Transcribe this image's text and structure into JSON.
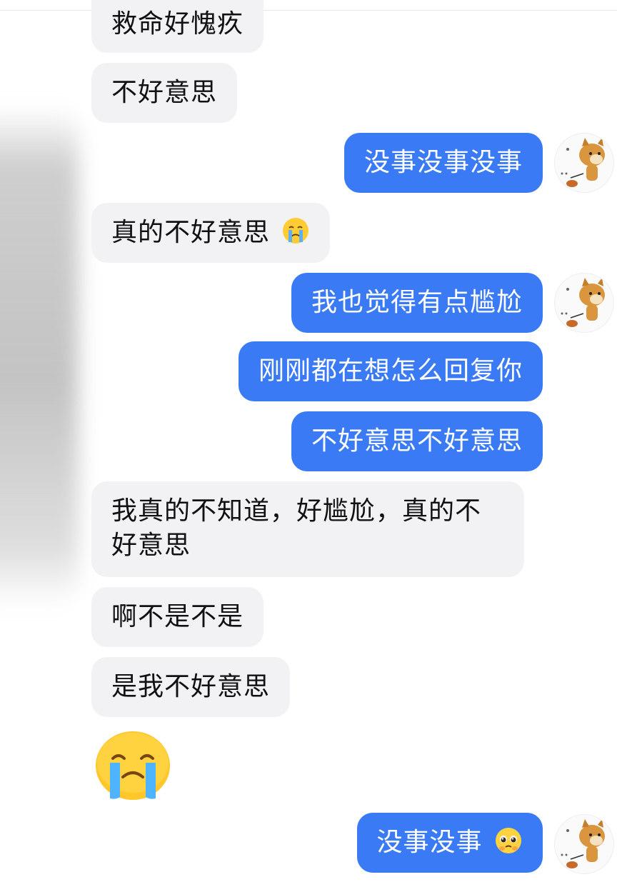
{
  "chat": {
    "messages": [
      {
        "side": "in",
        "text": "救命好愧疚"
      },
      {
        "side": "in",
        "text": "不好意思"
      },
      {
        "side": "out",
        "text": "没事没事没事"
      },
      {
        "side": "in",
        "text": "真的不好意思",
        "emoji": "crying-face"
      },
      {
        "side": "out",
        "text": "我也觉得有点尴尬"
      },
      {
        "side": "out",
        "text": "刚刚都在想怎么回复你"
      },
      {
        "side": "out",
        "text": "不好意思不好意思"
      },
      {
        "side": "in",
        "text": "我真的不知道，好尴尬，真的不好意思"
      },
      {
        "side": "in",
        "text": "啊不是不是"
      },
      {
        "side": "in",
        "text": "是我不好意思"
      },
      {
        "side": "in",
        "emoji": "loudly-crying-face"
      },
      {
        "side": "out",
        "text": "没事没事",
        "emoji": "pleading-face"
      }
    ],
    "avatar_icon": "shiba-dog-avatar-icon"
  },
  "colors": {
    "outgoing_bubble": "#3a7bf5",
    "incoming_bubble": "#f2f2f4",
    "background": "#ffffff"
  }
}
